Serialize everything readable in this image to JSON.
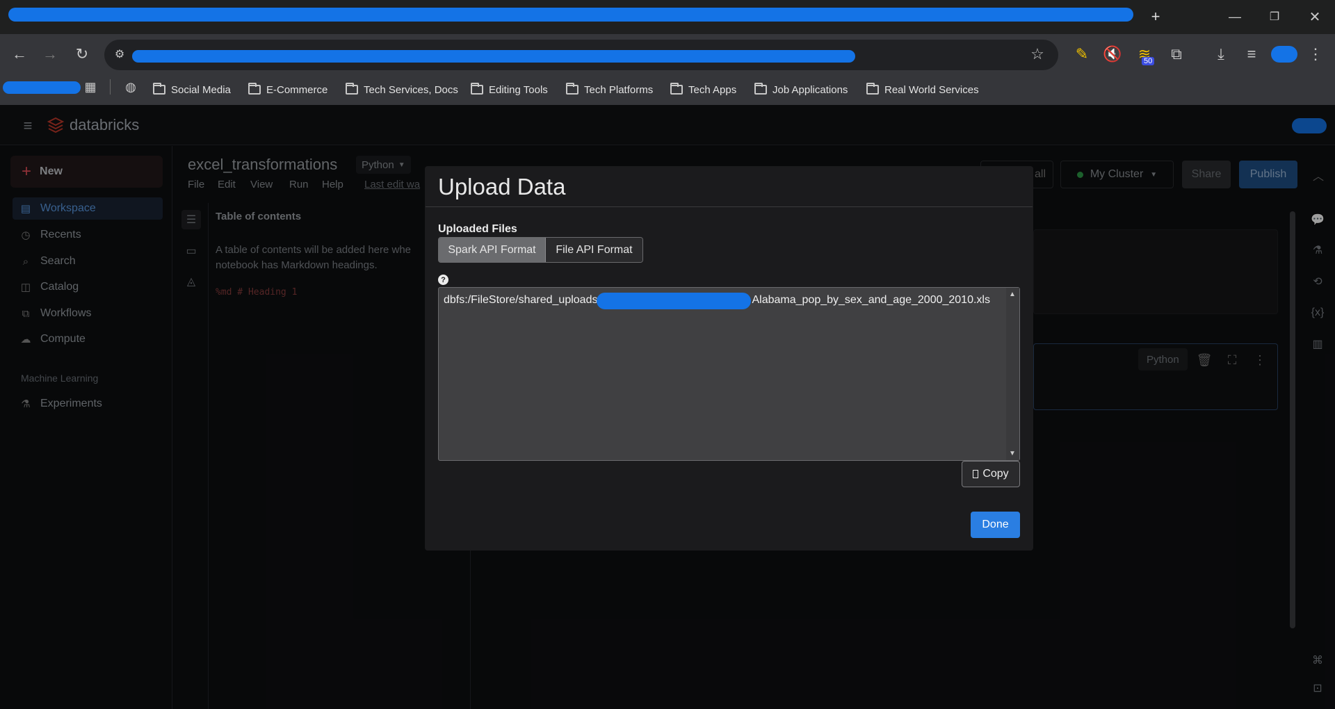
{
  "browser": {
    "bookmarks": [
      "Social Media",
      "E-Commerce",
      "Tech Services, Docs",
      "Editing Tools",
      "Tech Platforms",
      "Tech Apps",
      "Job Applications",
      "Real World Services"
    ],
    "extension_badge": "50"
  },
  "app": {
    "brand": "databricks",
    "accent": "#e8505b"
  },
  "sidebar": {
    "new_label": "New",
    "items": [
      {
        "label": "Workspace",
        "icon": "workspace-icon",
        "active": true
      },
      {
        "label": "Recents",
        "icon": "clock-icon"
      },
      {
        "label": "Search",
        "icon": "search-icon"
      },
      {
        "label": "Catalog",
        "icon": "catalog-icon"
      },
      {
        "label": "Workflows",
        "icon": "workflows-icon"
      },
      {
        "label": "Compute",
        "icon": "cloud-icon"
      }
    ],
    "section_label": "Machine Learning",
    "section_items": [
      {
        "label": "Experiments",
        "icon": "flask-icon"
      }
    ]
  },
  "notebook": {
    "title": "excel_transformations",
    "language": "Python",
    "menu": [
      "File",
      "Edit",
      "View",
      "Run",
      "Help"
    ],
    "last_edit": "Last edit wa",
    "run_all_partial": "all",
    "cluster": "My Cluster",
    "share_label": "Share",
    "publish_label": "Publish",
    "cell_language": "Python",
    "toc": {
      "title": "Table of contents",
      "description": "A table of contents will be added here whe notebook has Markdown headings.",
      "example": "%md # Heading 1"
    }
  },
  "modal": {
    "title": "Upload Data",
    "uploaded_files_label": "Uploaded Files",
    "tabs": [
      "Spark API Format",
      "File API Format"
    ],
    "selected_tab": "Spark API Format",
    "help_glyph": "?",
    "path_prefix": "dbfs:/FileStore/shared_uploads",
    "path_suffix": "Alabama_pop_by_sex_and_age_2000_2010.xls",
    "copy_label": "Copy",
    "done_label": "Done"
  }
}
